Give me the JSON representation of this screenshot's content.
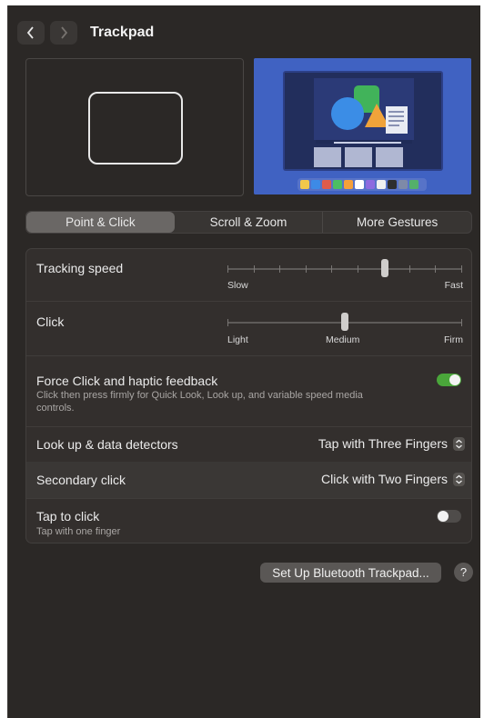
{
  "header": {
    "title": "Trackpad"
  },
  "tabs": [
    {
      "label": "Point & Click",
      "active": true
    },
    {
      "label": "Scroll & Zoom",
      "active": false
    },
    {
      "label": "More Gestures",
      "active": false
    }
  ],
  "settings": {
    "tracking_speed": {
      "label": "Tracking speed",
      "min_label": "Slow",
      "max_label": "Fast",
      "value_fraction": 0.67,
      "ticks": 10
    },
    "click": {
      "label": "Click",
      "left_label": "Light",
      "mid_label": "Medium",
      "right_label": "Firm",
      "value": "Medium"
    },
    "force_click": {
      "label": "Force Click and haptic feedback",
      "description": "Click then press firmly for Quick Look, Look up, and variable speed media controls.",
      "enabled": true
    },
    "look_up": {
      "label": "Look up & data detectors",
      "value": "Tap with Three Fingers"
    },
    "secondary_click": {
      "label": "Secondary click",
      "value": "Click with Two Fingers"
    },
    "tap_to_click": {
      "label": "Tap to click",
      "description": "Tap with one finger",
      "enabled": false
    }
  },
  "footer": {
    "bluetooth_button": "Set Up Bluetooth Trackpad...",
    "help_button": "?"
  },
  "colors": {
    "background": "#2b2826",
    "accent_toggle_on": "#4aa63a",
    "preview_blue": "#3c5bb8"
  },
  "icons": [
    "back-chevron-icon",
    "forward-chevron-icon",
    "up-down-chevron-icon",
    "help-icon"
  ]
}
